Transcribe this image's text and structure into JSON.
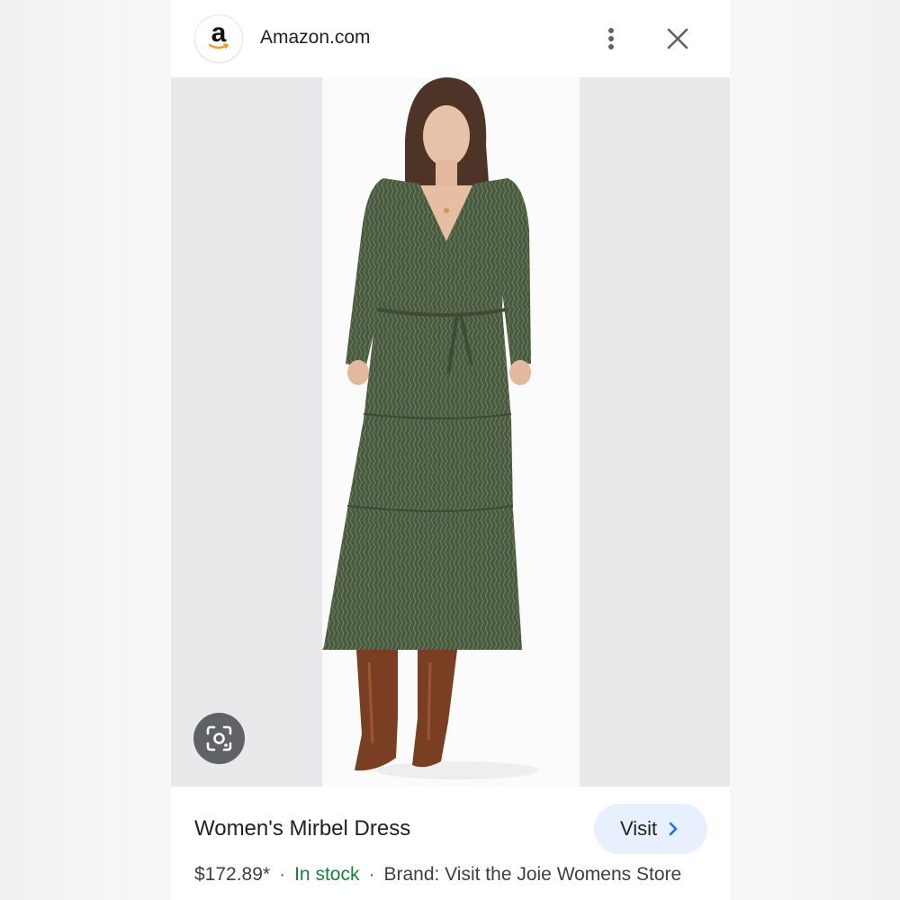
{
  "header": {
    "site_name": "Amazon.com",
    "logo_letter": "a",
    "more_icon": "more-vert-icon",
    "close_icon": "close-icon"
  },
  "image_viewer": {
    "lens_icon": "google-lens-icon",
    "dress_color": "#4a5a3f",
    "boot_color": "#7a3f22"
  },
  "product": {
    "title": "Women's Mirbel Dress",
    "price": "$172.89*",
    "separator": "·",
    "stock": "In stock",
    "brand": "Brand: Visit the Joie Womens Store",
    "visit_label": "Visit",
    "visit_icon": "chevron-right-icon"
  },
  "colors": {
    "stock_green": "#188038",
    "visit_bg": "#e8f0fe",
    "visit_arrow": "#1a73e8"
  }
}
